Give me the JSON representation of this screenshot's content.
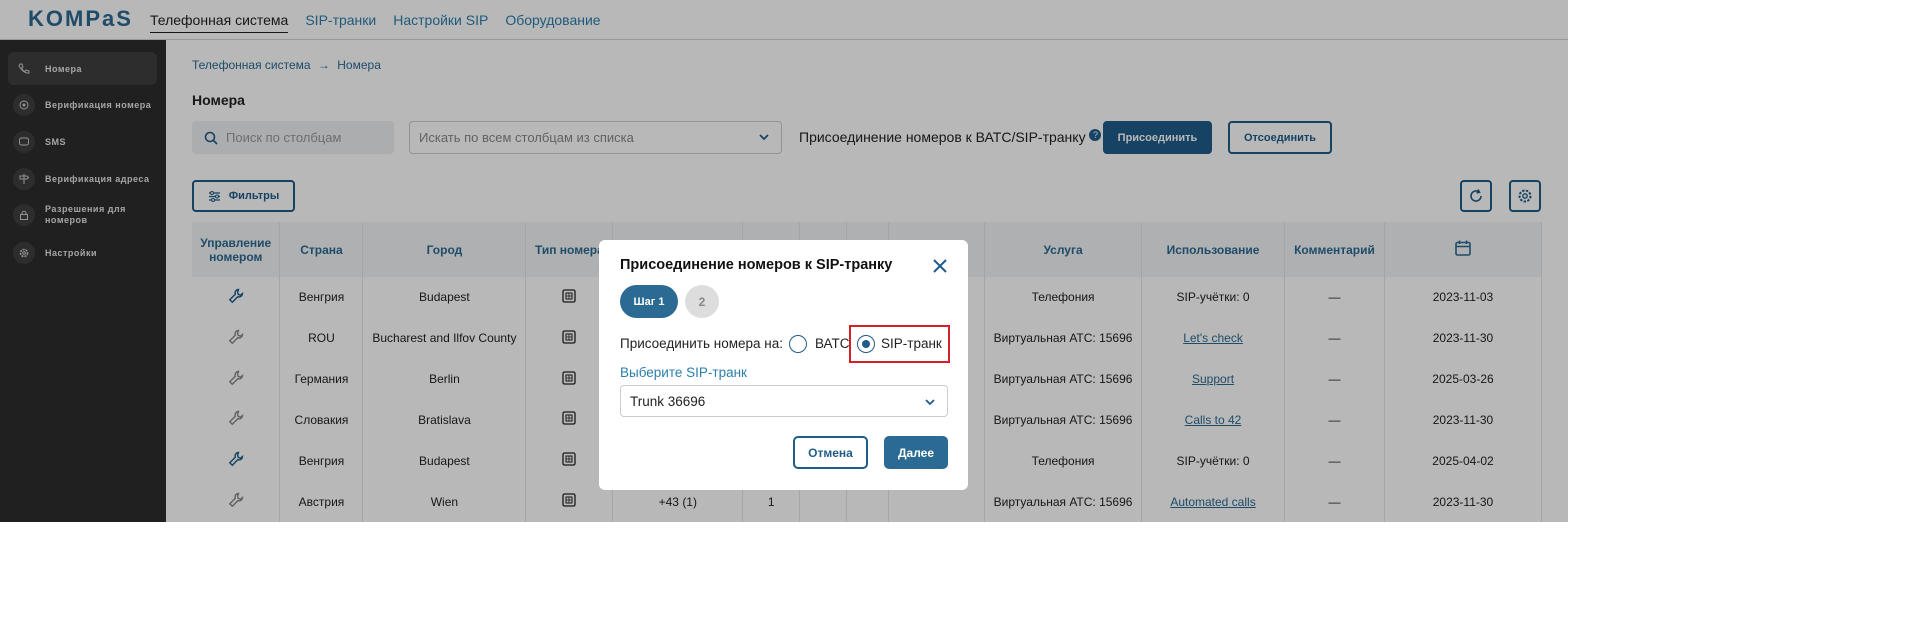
{
  "brand": {
    "logo": "KOMPaS"
  },
  "nav": {
    "items": [
      "Телефонная система",
      "SIP-транки",
      "Настройки SIP",
      "Оборудование"
    ]
  },
  "sidebar": {
    "items": [
      {
        "label": "Номера",
        "icon": "phone-icon"
      },
      {
        "label": "Верификация номера",
        "icon": "verify-icon"
      },
      {
        "label": "SMS",
        "icon": "sms-icon"
      },
      {
        "label": "Верификация адреса",
        "icon": "signpost-icon"
      },
      {
        "label": "Разрешения для номеров",
        "icon": "lock-icon"
      },
      {
        "label": "Настройки",
        "icon": "gear-icon"
      }
    ]
  },
  "breadcrumb": {
    "parent": "Телефонная система",
    "separator": "→",
    "current": "Номера"
  },
  "page": {
    "title": "Номера"
  },
  "toolbar": {
    "search_placeholder": "Поиск по столбцам",
    "select_placeholder": "Искать по всем столбцам из списка",
    "join_label": "Присоединение номеров к ВАТС/SIP-транку",
    "help": "?",
    "attach_button": "Присоединить",
    "detach_button": "Отсоединить",
    "filters_button": "Фильтры"
  },
  "table": {
    "headers": [
      "Управление номером",
      "Страна",
      "Город",
      "Тип номера",
      "",
      "",
      "",
      "",
      "",
      "Услуга",
      "Использование",
      "Комментарий",
      ""
    ],
    "rows": [
      {
        "country": "Венгрия",
        "city": "Budapest",
        "number": "",
        "col5": "",
        "service": "Телефония",
        "usage": "SIP-учётки: 0",
        "usage_link": false,
        "comment": "—",
        "date": "2023-11-03",
        "icon_active": true
      },
      {
        "country": "ROU",
        "city": "Bucharest and Ilfov County",
        "number": "",
        "col5": "",
        "service": "Виртуальная АТС: 15696",
        "usage": "Let's check",
        "usage_link": true,
        "comment": "—",
        "date": "2023-11-30",
        "icon_active": false
      },
      {
        "country": "Германия",
        "city": "Berlin",
        "number": "",
        "col5": "",
        "service": "Виртуальная АТС: 15696",
        "usage": "Support",
        "usage_link": true,
        "comment": "—",
        "date": "2025-03-26",
        "icon_active": false
      },
      {
        "country": "Словакия",
        "city": "Bratislava",
        "number": "",
        "col5": "",
        "service": "Виртуальная АТС: 15696",
        "usage": "Calls to 42",
        "usage_link": true,
        "comment": "—",
        "date": "2023-11-30",
        "icon_active": false
      },
      {
        "country": "Венгрия",
        "city": "Budapest",
        "number": "",
        "col5": "",
        "service": "Телефония",
        "usage": "SIP-учётки: 0",
        "usage_link": false,
        "comment": "—",
        "date": "2025-04-02",
        "icon_active": true
      },
      {
        "country": "Австрия",
        "city": "Wien",
        "number": "+43 (1)",
        "col5": "1",
        "service": "Виртуальная АТС: 15696",
        "usage": "Automated calls",
        "usage_link": true,
        "comment": "—",
        "date": "2023-11-30",
        "icon_active": false
      }
    ]
  },
  "modal": {
    "title": "Присоединение номеров к SIP-транку",
    "step1": "Шаг 1",
    "step2": "2",
    "attach_label": "Присоединить номера на:",
    "option_vats": "ВАТС",
    "option_sip": "SIP-транк",
    "selected_option": "SIP-транк",
    "select_label": "Выберите SIP-транк",
    "trunk_value": "Trunk 36696",
    "cancel": "Отмена",
    "next": "Далее"
  },
  "colors": {
    "primary": "#1f5c8a",
    "link": "#2b7fae",
    "sidebar": "#2d2d2d",
    "highlight": "#d61f26"
  }
}
